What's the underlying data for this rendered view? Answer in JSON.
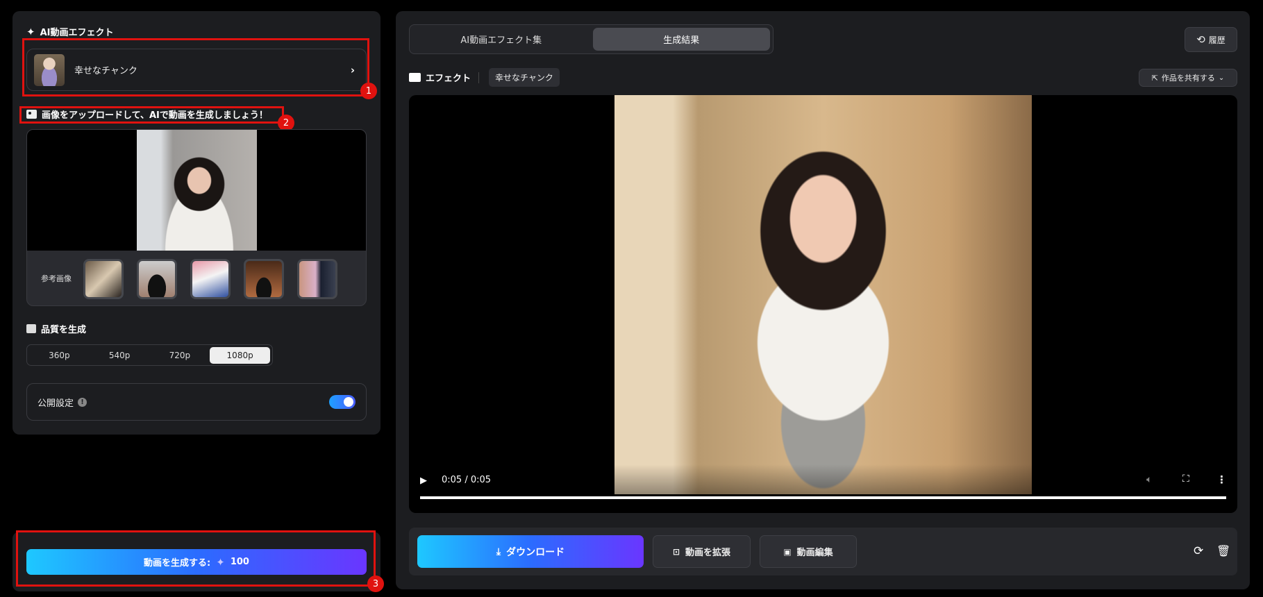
{
  "left": {
    "effect_title": "AI動画エフェクト",
    "effect_name": "幸せなチャンク",
    "upload_title": "画像をアップロードして、AIで動画を生成しましょう！",
    "reference_label": "参考画像",
    "reference_count": 5,
    "quality_title": "品質を生成",
    "quality_options": [
      "360p",
      "540p",
      "720p",
      "1080p"
    ],
    "quality_selected": "1080p",
    "public_label": "公開設定",
    "public_enabled": true,
    "generate_label": "動画を生成する:",
    "generate_cost": "100"
  },
  "right": {
    "tabs": [
      {
        "label": "AI動画エフェクト集",
        "active": false
      },
      {
        "label": "生成結果",
        "active": true
      }
    ],
    "history_label": "履歴",
    "effect_label": "エフェクト",
    "effect_tag": "幸せなチャンク",
    "share_label": "作品を共有する",
    "video": {
      "time": "0:05 / 0:05",
      "progress": 1.0
    },
    "download_label": "ダウンロード",
    "extend_label": "動画を拡張",
    "edit_label": "動画編集"
  },
  "annotations": [
    "1",
    "2",
    "3"
  ],
  "colors": {
    "accent_start": "#1ec8ff",
    "accent_end": "#6a36ff",
    "annotation": "#e0120f",
    "panel": "#1c1d20"
  }
}
